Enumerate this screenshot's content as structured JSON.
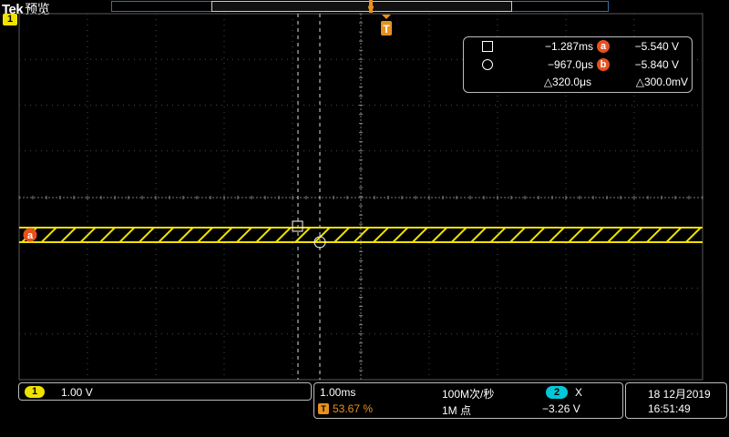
{
  "header": {
    "brand": "Tek",
    "mode": "预览"
  },
  "channel1_marker": "1",
  "trigger_marker": "T",
  "cursor_readout": {
    "cursor_a": {
      "time": "−1.287ms",
      "badge": "a",
      "voltage": "−5.540 V"
    },
    "cursor_b": {
      "time": "−967.0μs",
      "badge": "b",
      "voltage": "−5.840 V"
    },
    "delta_time": "△320.0μs",
    "delta_voltage": "△300.0mV"
  },
  "waveform_marker": "a",
  "status": {
    "ch1": {
      "number": "1",
      "scale": "1.00 V"
    },
    "horizontal": {
      "scale": "1.00ms",
      "trigger_icon": "T",
      "trigger_position": "53.67 %",
      "sample_rate": "100M次/秒",
      "record_length": "1M 点"
    },
    "trigger": {
      "source": "2",
      "type": "X",
      "level": "−3.26 V"
    },
    "datetime": {
      "date": "18 12月2019",
      "time": "16:51:49"
    }
  },
  "colors": {
    "ch1": "#f0e200",
    "ch2": "#00c8d8",
    "trigger": "#e8901e",
    "cursor_badge": "#e8501e",
    "grid": "#5a5a5a"
  }
}
